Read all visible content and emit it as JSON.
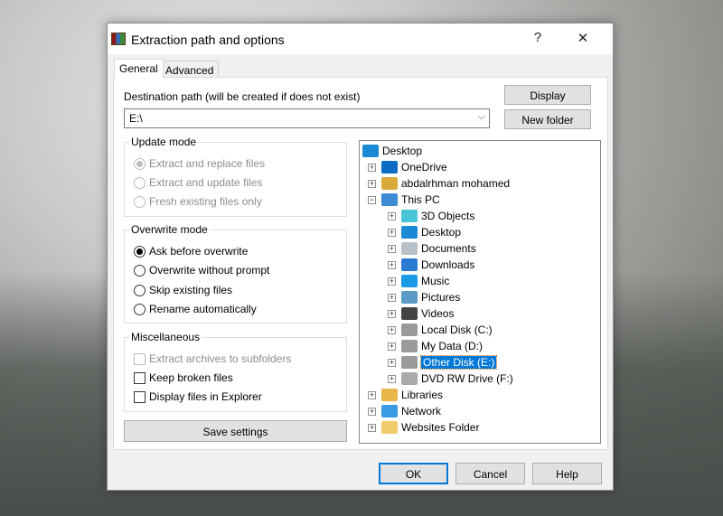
{
  "dialog": {
    "title": "Extraction path and options",
    "help": "?",
    "close": "✕"
  },
  "tabs": [
    {
      "label": "General",
      "active": true
    },
    {
      "label": "Advanced",
      "active": false
    }
  ],
  "destination": {
    "label": "Destination path (will be created if does not exist)",
    "value": "E:\\"
  },
  "buttons": {
    "display": "Display",
    "new_folder": "New folder",
    "save_settings": "Save settings",
    "ok": "OK",
    "cancel": "Cancel",
    "help": "Help"
  },
  "update_mode": {
    "label": "Update mode",
    "options": [
      {
        "label": "Extract and replace files",
        "checked": true,
        "disabled": true
      },
      {
        "label": "Extract and update files",
        "checked": false,
        "disabled": true
      },
      {
        "label": "Fresh existing files only",
        "checked": false,
        "disabled": true
      }
    ]
  },
  "overwrite_mode": {
    "label": "Overwrite mode",
    "options": [
      {
        "label": "Ask before overwrite",
        "checked": true
      },
      {
        "label": "Overwrite without prompt",
        "checked": false
      },
      {
        "label": "Skip existing files",
        "checked": false
      },
      {
        "label": "Rename automatically",
        "checked": false
      }
    ]
  },
  "misc": {
    "label": "Miscellaneous",
    "options": [
      {
        "label": "Extract archives to subfolders",
        "checked": false,
        "disabled": true
      },
      {
        "label": "Keep broken files",
        "checked": false
      },
      {
        "label": "Display files in Explorer",
        "checked": false
      }
    ]
  },
  "tree": [
    {
      "label": "Desktop",
      "level": 0,
      "icon": "desktop-icon",
      "color": "#1a8ad4"
    },
    {
      "label": "OneDrive",
      "level": 1,
      "icon": "cloud-icon",
      "color": "#0a6cc4",
      "expander": "+"
    },
    {
      "label": "abdalrhman mohamed",
      "level": 1,
      "icon": "user-folder-icon",
      "color": "#d9a93a",
      "expander": "+"
    },
    {
      "label": "This PC",
      "level": 1,
      "icon": "computer-icon",
      "color": "#3a8ad4",
      "expander": "−"
    },
    {
      "label": "3D Objects",
      "level": 2,
      "icon": "cube-icon",
      "color": "#4ac4d8",
      "expander": "+"
    },
    {
      "label": "Desktop",
      "level": 2,
      "icon": "desktop-icon",
      "color": "#1a8ad4",
      "expander": "+"
    },
    {
      "label": "Documents",
      "level": 2,
      "icon": "document-icon",
      "color": "#b8c0c8",
      "expander": "+"
    },
    {
      "label": "Downloads",
      "level": 2,
      "icon": "download-arrow-icon",
      "color": "#2a7ad4",
      "expander": "+"
    },
    {
      "label": "Music",
      "level": 2,
      "icon": "music-note-icon",
      "color": "#1a9ae4",
      "expander": "+"
    },
    {
      "label": "Pictures",
      "level": 2,
      "icon": "pictures-icon",
      "color": "#5a9ac4",
      "expander": "+"
    },
    {
      "label": "Videos",
      "level": 2,
      "icon": "film-icon",
      "color": "#444444",
      "expander": "+"
    },
    {
      "label": "Local Disk (C:)",
      "level": 2,
      "icon": "windows-drive-icon",
      "color": "#9a9a9a",
      "expander": "+"
    },
    {
      "label": "My Data (D:)",
      "level": 2,
      "icon": "drive-icon",
      "color": "#9a9a9a",
      "expander": "+"
    },
    {
      "label": "Other Disk (E:)",
      "level": 2,
      "icon": "drive-icon",
      "color": "#9a9a9a",
      "expander": "+",
      "selected": true
    },
    {
      "label": "DVD RW Drive (F:)",
      "level": 2,
      "icon": "dvd-drive-icon",
      "color": "#aaaaaa",
      "expander": "+"
    },
    {
      "label": "Libraries",
      "level": 1,
      "icon": "libraries-folder-icon",
      "color": "#e8b84a",
      "expander": "+"
    },
    {
      "label": "Network",
      "level": 1,
      "icon": "network-icon",
      "color": "#3a9ae4",
      "expander": "+"
    },
    {
      "label": "Websites Folder",
      "level": 1,
      "icon": "folder-icon",
      "color": "#f0cc6a",
      "expander": "+"
    }
  ]
}
